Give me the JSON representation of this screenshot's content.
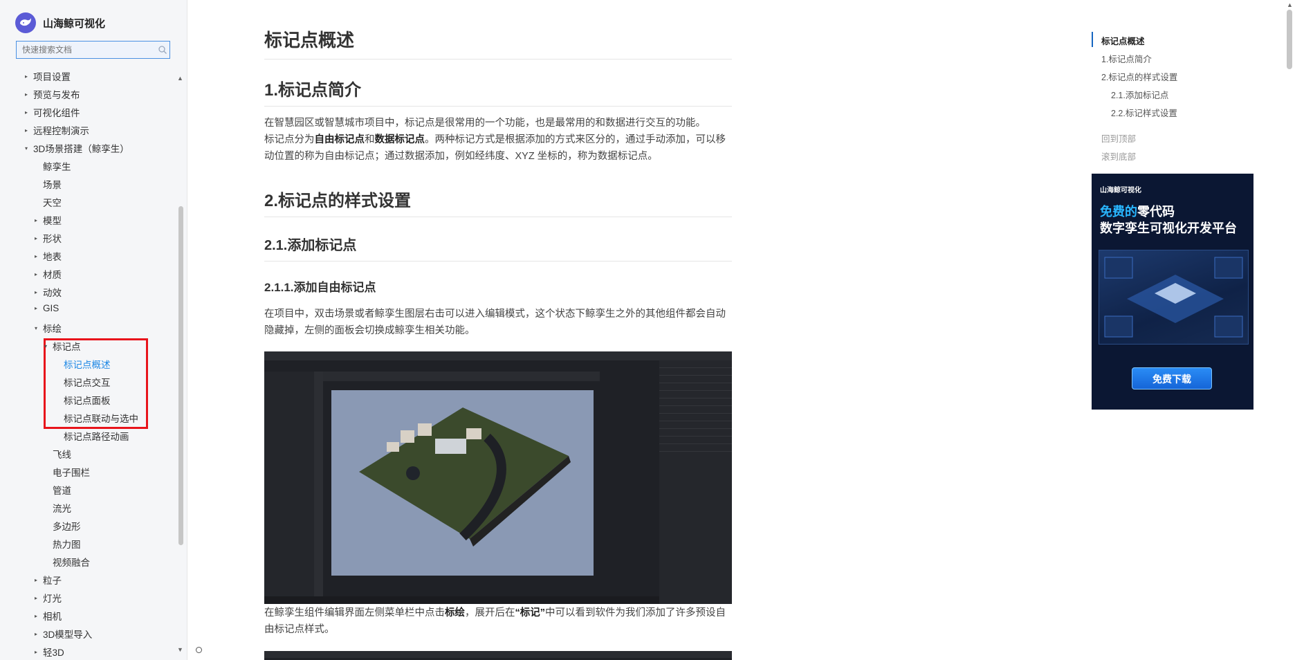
{
  "brand": {
    "name": "山海鲸可视化",
    "logo_icon": "whale-logo-icon"
  },
  "search": {
    "placeholder": "快速搜索文档"
  },
  "sidebar": {
    "items": [
      {
        "label": "项目设置",
        "caret": "▸"
      },
      {
        "label": "预览与发布",
        "caret": "▸"
      },
      {
        "label": "可视化组件",
        "caret": "▸"
      },
      {
        "label": "远程控制演示",
        "caret": "▸"
      },
      {
        "label": "3D场景搭建（鲸孪生）",
        "caret": "▾"
      },
      {
        "label": "鲸孪生",
        "caret": ""
      },
      {
        "label": "场景",
        "caret": ""
      },
      {
        "label": "天空",
        "caret": ""
      },
      {
        "label": "模型",
        "caret": "▸"
      },
      {
        "label": "形状",
        "caret": "▸"
      },
      {
        "label": "地表",
        "caret": "▸"
      },
      {
        "label": "材质",
        "caret": "▸"
      },
      {
        "label": "动效",
        "caret": "▸"
      },
      {
        "label": "GIS",
        "caret": "▸"
      },
      {
        "label": "标绘",
        "caret": "▾"
      },
      {
        "label": "标记点",
        "caret": "▾"
      },
      {
        "label": "标记点概述",
        "caret": ""
      },
      {
        "label": "标记点交互",
        "caret": ""
      },
      {
        "label": "标记点面板",
        "caret": ""
      },
      {
        "label": "标记点联动与选中",
        "caret": ""
      },
      {
        "label": "标记点路径动画",
        "caret": ""
      },
      {
        "label": "飞线",
        "caret": ""
      },
      {
        "label": "电子围栏",
        "caret": ""
      },
      {
        "label": "管道",
        "caret": ""
      },
      {
        "label": "流光",
        "caret": ""
      },
      {
        "label": "多边形",
        "caret": ""
      },
      {
        "label": "热力图",
        "caret": ""
      },
      {
        "label": "视频融合",
        "caret": ""
      },
      {
        "label": "粒子",
        "caret": "▸"
      },
      {
        "label": "灯光",
        "caret": "▸"
      },
      {
        "label": "相机",
        "caret": "▸"
      },
      {
        "label": "3D模型导入",
        "caret": "▸"
      },
      {
        "label": "轻3D",
        "caret": "▸"
      }
    ]
  },
  "article": {
    "title": "标记点概述",
    "s1_heading": "1.标记点简介",
    "s1_p1": "在智慧园区或智慧城市项目中，标记点是很常用的一个功能，也是最常用的和数据进行交互的功能。",
    "s1_p2_a": "标记点分为",
    "s1_p2_b": "自由标记点",
    "s1_p2_c": "和",
    "s1_p2_d": "数据标记点",
    "s1_p2_e": "。两种标记方式是根据添加的方式来区分的，通过手动添加，可以移动位置的称为自由标记点；通过数据添加，例如经纬度、XYZ 坐标的，称为数据标记点。",
    "s2_heading": "2.标记点的样式设置",
    "s21_heading": "2.1.添加标记点",
    "s211_heading": "2.1.1.添加自由标记点",
    "s211_p1": "在项目中，双击场景或者鲸孪生图层右击可以进入编辑模式，这个状态下鲸孪生之外的其他组件都会自动隐藏掉，左侧的面板会切换成鲸孪生相关功能。",
    "s211_p2_a": "在鲸孪生组件编辑界面左侧菜单栏中点击",
    "s211_p2_b": "标绘",
    "s211_p2_c": "，展开后在",
    "s211_p2_d": "“标记”",
    "s211_p2_e": "中可以看到软件为我们添加了许多预设自由标记点样式。"
  },
  "toc": {
    "items": [
      {
        "label": "标记点概述"
      },
      {
        "label": "1.标记点简介"
      },
      {
        "label": "2.标记点的样式设置"
      },
      {
        "label": "2.1.添加标记点"
      },
      {
        "label": "2.2.标记样式设置"
      }
    ],
    "back_top": "回到顶部",
    "to_bottom": "滚到底部"
  },
  "ad": {
    "brand": "山海鲸可视化",
    "line1_highlight": "免费的",
    "line1_rest": "零代码",
    "line2": "数字孪生可视化开发平台",
    "button": "免费下载"
  },
  "colors": {
    "accent": "#1e88e5",
    "highlight_box": "#e8141b",
    "ad_bg": "#0b1733"
  }
}
